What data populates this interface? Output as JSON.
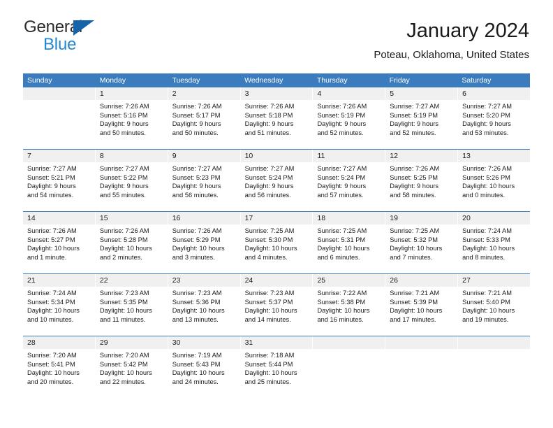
{
  "brand": {
    "name_part1": "General",
    "name_part2": "Blue",
    "triangle_color": "#1563a8",
    "text_color": "#2b2b2b",
    "accent_color": "#2487d4"
  },
  "header": {
    "title": "January 2024",
    "subtitle": "Poteau, Oklahoma, United States"
  },
  "theme": {
    "header_bg": "#3a7cbe",
    "header_text": "#ffffff",
    "daynum_bg": "#f0f0f0",
    "cell_bg": "#ffffff",
    "text": "#1a1a1a"
  },
  "weekdays": [
    "Sunday",
    "Monday",
    "Tuesday",
    "Wednesday",
    "Thursday",
    "Friday",
    "Saturday"
  ],
  "weeks": [
    [
      {
        "day": "",
        "empty": true,
        "sunrise": "",
        "sunset": "",
        "daylight1": "",
        "daylight2": ""
      },
      {
        "day": "1",
        "sunrise": "Sunrise: 7:26 AM",
        "sunset": "Sunset: 5:16 PM",
        "daylight1": "Daylight: 9 hours",
        "daylight2": "and 50 minutes."
      },
      {
        "day": "2",
        "sunrise": "Sunrise: 7:26 AM",
        "sunset": "Sunset: 5:17 PM",
        "daylight1": "Daylight: 9 hours",
        "daylight2": "and 50 minutes."
      },
      {
        "day": "3",
        "sunrise": "Sunrise: 7:26 AM",
        "sunset": "Sunset: 5:18 PM",
        "daylight1": "Daylight: 9 hours",
        "daylight2": "and 51 minutes."
      },
      {
        "day": "4",
        "sunrise": "Sunrise: 7:26 AM",
        "sunset": "Sunset: 5:19 PM",
        "daylight1": "Daylight: 9 hours",
        "daylight2": "and 52 minutes."
      },
      {
        "day": "5",
        "sunrise": "Sunrise: 7:27 AM",
        "sunset": "Sunset: 5:19 PM",
        "daylight1": "Daylight: 9 hours",
        "daylight2": "and 52 minutes."
      },
      {
        "day": "6",
        "sunrise": "Sunrise: 7:27 AM",
        "sunset": "Sunset: 5:20 PM",
        "daylight1": "Daylight: 9 hours",
        "daylight2": "and 53 minutes."
      }
    ],
    [
      {
        "day": "7",
        "sunrise": "Sunrise: 7:27 AM",
        "sunset": "Sunset: 5:21 PM",
        "daylight1": "Daylight: 9 hours",
        "daylight2": "and 54 minutes."
      },
      {
        "day": "8",
        "sunrise": "Sunrise: 7:27 AM",
        "sunset": "Sunset: 5:22 PM",
        "daylight1": "Daylight: 9 hours",
        "daylight2": "and 55 minutes."
      },
      {
        "day": "9",
        "sunrise": "Sunrise: 7:27 AM",
        "sunset": "Sunset: 5:23 PM",
        "daylight1": "Daylight: 9 hours",
        "daylight2": "and 56 minutes."
      },
      {
        "day": "10",
        "sunrise": "Sunrise: 7:27 AM",
        "sunset": "Sunset: 5:24 PM",
        "daylight1": "Daylight: 9 hours",
        "daylight2": "and 56 minutes."
      },
      {
        "day": "11",
        "sunrise": "Sunrise: 7:27 AM",
        "sunset": "Sunset: 5:24 PM",
        "daylight1": "Daylight: 9 hours",
        "daylight2": "and 57 minutes."
      },
      {
        "day": "12",
        "sunrise": "Sunrise: 7:26 AM",
        "sunset": "Sunset: 5:25 PM",
        "daylight1": "Daylight: 9 hours",
        "daylight2": "and 58 minutes."
      },
      {
        "day": "13",
        "sunrise": "Sunrise: 7:26 AM",
        "sunset": "Sunset: 5:26 PM",
        "daylight1": "Daylight: 10 hours",
        "daylight2": "and 0 minutes."
      }
    ],
    [
      {
        "day": "14",
        "sunrise": "Sunrise: 7:26 AM",
        "sunset": "Sunset: 5:27 PM",
        "daylight1": "Daylight: 10 hours",
        "daylight2": "and 1 minute."
      },
      {
        "day": "15",
        "sunrise": "Sunrise: 7:26 AM",
        "sunset": "Sunset: 5:28 PM",
        "daylight1": "Daylight: 10 hours",
        "daylight2": "and 2 minutes."
      },
      {
        "day": "16",
        "sunrise": "Sunrise: 7:26 AM",
        "sunset": "Sunset: 5:29 PM",
        "daylight1": "Daylight: 10 hours",
        "daylight2": "and 3 minutes."
      },
      {
        "day": "17",
        "sunrise": "Sunrise: 7:25 AM",
        "sunset": "Sunset: 5:30 PM",
        "daylight1": "Daylight: 10 hours",
        "daylight2": "and 4 minutes."
      },
      {
        "day": "18",
        "sunrise": "Sunrise: 7:25 AM",
        "sunset": "Sunset: 5:31 PM",
        "daylight1": "Daylight: 10 hours",
        "daylight2": "and 6 minutes."
      },
      {
        "day": "19",
        "sunrise": "Sunrise: 7:25 AM",
        "sunset": "Sunset: 5:32 PM",
        "daylight1": "Daylight: 10 hours",
        "daylight2": "and 7 minutes."
      },
      {
        "day": "20",
        "sunrise": "Sunrise: 7:24 AM",
        "sunset": "Sunset: 5:33 PM",
        "daylight1": "Daylight: 10 hours",
        "daylight2": "and 8 minutes."
      }
    ],
    [
      {
        "day": "21",
        "sunrise": "Sunrise: 7:24 AM",
        "sunset": "Sunset: 5:34 PM",
        "daylight1": "Daylight: 10 hours",
        "daylight2": "and 10 minutes."
      },
      {
        "day": "22",
        "sunrise": "Sunrise: 7:23 AM",
        "sunset": "Sunset: 5:35 PM",
        "daylight1": "Daylight: 10 hours",
        "daylight2": "and 11 minutes."
      },
      {
        "day": "23",
        "sunrise": "Sunrise: 7:23 AM",
        "sunset": "Sunset: 5:36 PM",
        "daylight1": "Daylight: 10 hours",
        "daylight2": "and 13 minutes."
      },
      {
        "day": "24",
        "sunrise": "Sunrise: 7:23 AM",
        "sunset": "Sunset: 5:37 PM",
        "daylight1": "Daylight: 10 hours",
        "daylight2": "and 14 minutes."
      },
      {
        "day": "25",
        "sunrise": "Sunrise: 7:22 AM",
        "sunset": "Sunset: 5:38 PM",
        "daylight1": "Daylight: 10 hours",
        "daylight2": "and 16 minutes."
      },
      {
        "day": "26",
        "sunrise": "Sunrise: 7:21 AM",
        "sunset": "Sunset: 5:39 PM",
        "daylight1": "Daylight: 10 hours",
        "daylight2": "and 17 minutes."
      },
      {
        "day": "27",
        "sunrise": "Sunrise: 7:21 AM",
        "sunset": "Sunset: 5:40 PM",
        "daylight1": "Daylight: 10 hours",
        "daylight2": "and 19 minutes."
      }
    ],
    [
      {
        "day": "28",
        "sunrise": "Sunrise: 7:20 AM",
        "sunset": "Sunset: 5:41 PM",
        "daylight1": "Daylight: 10 hours",
        "daylight2": "and 20 minutes."
      },
      {
        "day": "29",
        "sunrise": "Sunrise: 7:20 AM",
        "sunset": "Sunset: 5:42 PM",
        "daylight1": "Daylight: 10 hours",
        "daylight2": "and 22 minutes."
      },
      {
        "day": "30",
        "sunrise": "Sunrise: 7:19 AM",
        "sunset": "Sunset: 5:43 PM",
        "daylight1": "Daylight: 10 hours",
        "daylight2": "and 24 minutes."
      },
      {
        "day": "31",
        "sunrise": "Sunrise: 7:18 AM",
        "sunset": "Sunset: 5:44 PM",
        "daylight1": "Daylight: 10 hours",
        "daylight2": "and 25 minutes."
      },
      {
        "day": "",
        "empty": true,
        "sunrise": "",
        "sunset": "",
        "daylight1": "",
        "daylight2": ""
      },
      {
        "day": "",
        "empty": true,
        "sunrise": "",
        "sunset": "",
        "daylight1": "",
        "daylight2": ""
      },
      {
        "day": "",
        "empty": true,
        "sunrise": "",
        "sunset": "",
        "daylight1": "",
        "daylight2": ""
      }
    ]
  ]
}
